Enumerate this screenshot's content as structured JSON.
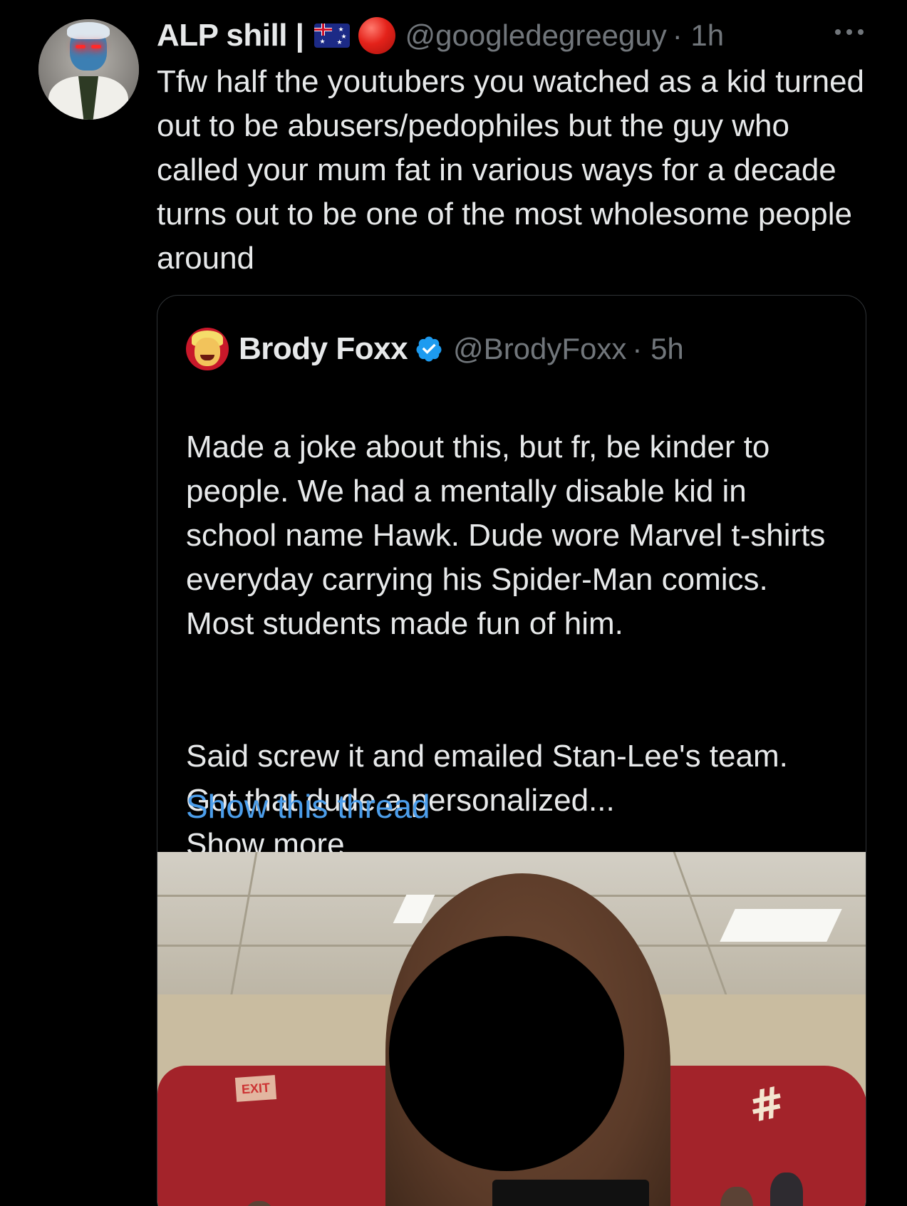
{
  "tweet": {
    "author_name": "ALP shill |",
    "author_handle": "@googledegreeguy",
    "time": "· 1h",
    "text": "Tfw half the youtubers you watched as a kid turned out to be abusers/pedophiles but the guy who called your mum fat in various ways for a decade turns out to be one of the most wholesome people around",
    "icons": [
      "avatar",
      "australian-flag-icon",
      "red-circle-icon",
      "more-options-icon"
    ]
  },
  "quote": {
    "author_name": "Brody Foxx",
    "author_handle": "@BrodyFoxx",
    "time": "· 5h",
    "paragraph1": "Made a joke about this, but fr, be kinder to people. We had a mentally disable kid in school name Hawk. Dude wore Marvel t-shirts everyday carrying his Spider-Man comics. Most students made fun of him.",
    "paragraph2_start": "Said screw it and emailed Stan-Lee's team. Got that dude a personalized...",
    "show_more": "Show more",
    "show_thread": "Show this thread",
    "verified_color": "#1d9bf0",
    "link_color": "#4c9eeb"
  },
  "media": {
    "exit_sign": "EXIT",
    "graffiti": "#"
  }
}
